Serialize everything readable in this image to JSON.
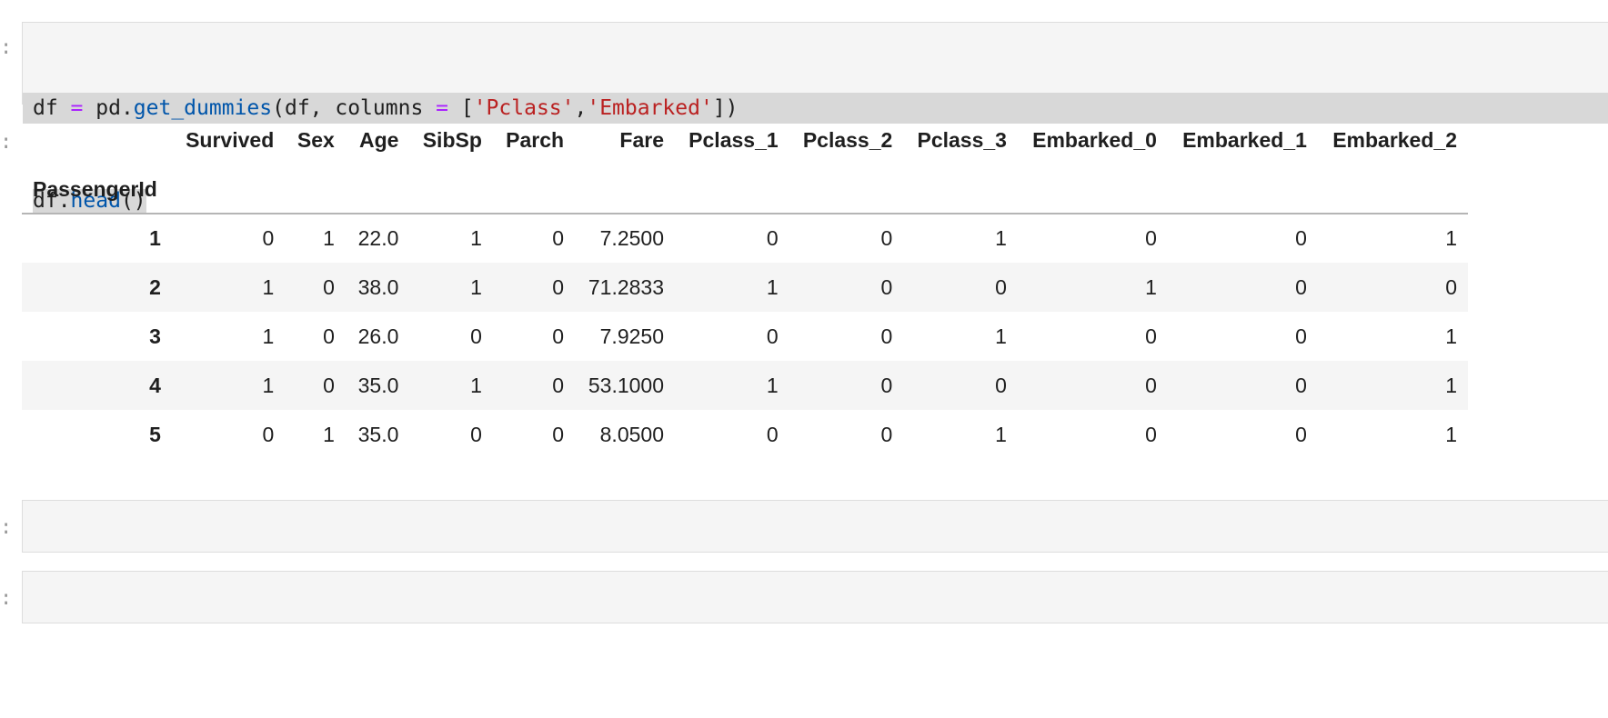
{
  "code_cell": {
    "prompt": ":",
    "line1": [
      {
        "t": "df ",
        "c": "plain"
      },
      {
        "t": "=",
        "c": "op"
      },
      {
        "t": " pd.",
        "c": "plain"
      },
      {
        "t": "get_dummies",
        "c": "fn"
      },
      {
        "t": "(df, columns ",
        "c": "plain"
      },
      {
        "t": "=",
        "c": "op"
      },
      {
        "t": " [",
        "c": "plain"
      },
      {
        "t": "'Pclass'",
        "c": "str"
      },
      {
        "t": ",",
        "c": "plain"
      },
      {
        "t": "'Embarked'",
        "c": "str"
      },
      {
        "t": "])",
        "c": "plain"
      }
    ],
    "line2": [
      {
        "t": "df.",
        "c": "plain"
      },
      {
        "t": "head",
        "c": "fn"
      },
      {
        "t": "()",
        "c": "plain"
      }
    ]
  },
  "output_cell": {
    "prompt": ":",
    "index_name": "PassengerId",
    "columns": [
      "Survived",
      "Sex",
      "Age",
      "SibSp",
      "Parch",
      "Fare",
      "Pclass_1",
      "Pclass_2",
      "Pclass_3",
      "Embarked_0",
      "Embarked_1",
      "Embarked_2"
    ],
    "rows": [
      {
        "index": "1",
        "values": [
          "0",
          "1",
          "22.0",
          "1",
          "0",
          "7.2500",
          "0",
          "0",
          "1",
          "0",
          "0",
          "1"
        ]
      },
      {
        "index": "2",
        "values": [
          "1",
          "0",
          "38.0",
          "1",
          "0",
          "71.2833",
          "1",
          "0",
          "0",
          "1",
          "0",
          "0"
        ]
      },
      {
        "index": "3",
        "values": [
          "1",
          "0",
          "26.0",
          "0",
          "0",
          "7.9250",
          "0",
          "0",
          "1",
          "0",
          "0",
          "1"
        ]
      },
      {
        "index": "4",
        "values": [
          "1",
          "0",
          "35.0",
          "1",
          "0",
          "53.1000",
          "1",
          "0",
          "0",
          "0",
          "0",
          "1"
        ]
      },
      {
        "index": "5",
        "values": [
          "0",
          "1",
          "35.0",
          "0",
          "0",
          "8.0500",
          "0",
          "0",
          "1",
          "0",
          "0",
          "1"
        ]
      }
    ]
  },
  "empty_cells": [
    {
      "prompt": ":"
    },
    {
      "prompt": ":"
    }
  ]
}
